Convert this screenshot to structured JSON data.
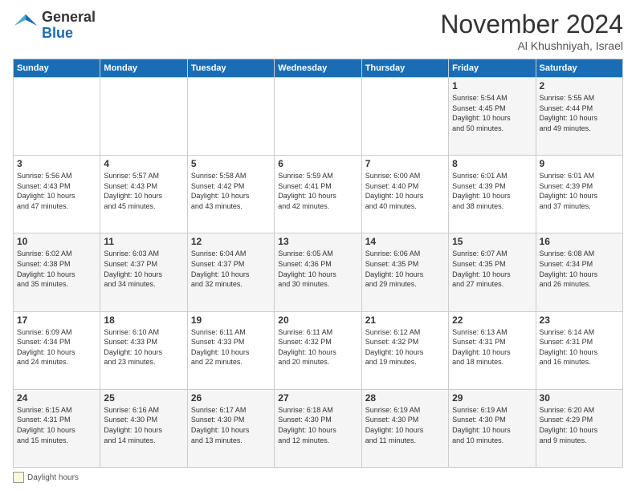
{
  "header": {
    "logo_general": "General",
    "logo_blue": "Blue",
    "month_title": "November 2024",
    "subtitle": "Al Khushniyah, Israel"
  },
  "days_of_week": [
    "Sunday",
    "Monday",
    "Tuesday",
    "Wednesday",
    "Thursday",
    "Friday",
    "Saturday"
  ],
  "weeks": [
    [
      {
        "day": "",
        "info": ""
      },
      {
        "day": "",
        "info": ""
      },
      {
        "day": "",
        "info": ""
      },
      {
        "day": "",
        "info": ""
      },
      {
        "day": "",
        "info": ""
      },
      {
        "day": "1",
        "info": "Sunrise: 5:54 AM\nSunset: 4:45 PM\nDaylight: 10 hours\nand 50 minutes."
      },
      {
        "day": "2",
        "info": "Sunrise: 5:55 AM\nSunset: 4:44 PM\nDaylight: 10 hours\nand 49 minutes."
      }
    ],
    [
      {
        "day": "3",
        "info": "Sunrise: 5:56 AM\nSunset: 4:43 PM\nDaylight: 10 hours\nand 47 minutes."
      },
      {
        "day": "4",
        "info": "Sunrise: 5:57 AM\nSunset: 4:43 PM\nDaylight: 10 hours\nand 45 minutes."
      },
      {
        "day": "5",
        "info": "Sunrise: 5:58 AM\nSunset: 4:42 PM\nDaylight: 10 hours\nand 43 minutes."
      },
      {
        "day": "6",
        "info": "Sunrise: 5:59 AM\nSunset: 4:41 PM\nDaylight: 10 hours\nand 42 minutes."
      },
      {
        "day": "7",
        "info": "Sunrise: 6:00 AM\nSunset: 4:40 PM\nDaylight: 10 hours\nand 40 minutes."
      },
      {
        "day": "8",
        "info": "Sunrise: 6:01 AM\nSunset: 4:39 PM\nDaylight: 10 hours\nand 38 minutes."
      },
      {
        "day": "9",
        "info": "Sunrise: 6:01 AM\nSunset: 4:39 PM\nDaylight: 10 hours\nand 37 minutes."
      }
    ],
    [
      {
        "day": "10",
        "info": "Sunrise: 6:02 AM\nSunset: 4:38 PM\nDaylight: 10 hours\nand 35 minutes."
      },
      {
        "day": "11",
        "info": "Sunrise: 6:03 AM\nSunset: 4:37 PM\nDaylight: 10 hours\nand 34 minutes."
      },
      {
        "day": "12",
        "info": "Sunrise: 6:04 AM\nSunset: 4:37 PM\nDaylight: 10 hours\nand 32 minutes."
      },
      {
        "day": "13",
        "info": "Sunrise: 6:05 AM\nSunset: 4:36 PM\nDaylight: 10 hours\nand 30 minutes."
      },
      {
        "day": "14",
        "info": "Sunrise: 6:06 AM\nSunset: 4:35 PM\nDaylight: 10 hours\nand 29 minutes."
      },
      {
        "day": "15",
        "info": "Sunrise: 6:07 AM\nSunset: 4:35 PM\nDaylight: 10 hours\nand 27 minutes."
      },
      {
        "day": "16",
        "info": "Sunrise: 6:08 AM\nSunset: 4:34 PM\nDaylight: 10 hours\nand 26 minutes."
      }
    ],
    [
      {
        "day": "17",
        "info": "Sunrise: 6:09 AM\nSunset: 4:34 PM\nDaylight: 10 hours\nand 24 minutes."
      },
      {
        "day": "18",
        "info": "Sunrise: 6:10 AM\nSunset: 4:33 PM\nDaylight: 10 hours\nand 23 minutes."
      },
      {
        "day": "19",
        "info": "Sunrise: 6:11 AM\nSunset: 4:33 PM\nDaylight: 10 hours\nand 22 minutes."
      },
      {
        "day": "20",
        "info": "Sunrise: 6:11 AM\nSunset: 4:32 PM\nDaylight: 10 hours\nand 20 minutes."
      },
      {
        "day": "21",
        "info": "Sunrise: 6:12 AM\nSunset: 4:32 PM\nDaylight: 10 hours\nand 19 minutes."
      },
      {
        "day": "22",
        "info": "Sunrise: 6:13 AM\nSunset: 4:31 PM\nDaylight: 10 hours\nand 18 minutes."
      },
      {
        "day": "23",
        "info": "Sunrise: 6:14 AM\nSunset: 4:31 PM\nDaylight: 10 hours\nand 16 minutes."
      }
    ],
    [
      {
        "day": "24",
        "info": "Sunrise: 6:15 AM\nSunset: 4:31 PM\nDaylight: 10 hours\nand 15 minutes."
      },
      {
        "day": "25",
        "info": "Sunrise: 6:16 AM\nSunset: 4:30 PM\nDaylight: 10 hours\nand 14 minutes."
      },
      {
        "day": "26",
        "info": "Sunrise: 6:17 AM\nSunset: 4:30 PM\nDaylight: 10 hours\nand 13 minutes."
      },
      {
        "day": "27",
        "info": "Sunrise: 6:18 AM\nSunset: 4:30 PM\nDaylight: 10 hours\nand 12 minutes."
      },
      {
        "day": "28",
        "info": "Sunrise: 6:19 AM\nSunset: 4:30 PM\nDaylight: 10 hours\nand 11 minutes."
      },
      {
        "day": "29",
        "info": "Sunrise: 6:19 AM\nSunset: 4:30 PM\nDaylight: 10 hours\nand 10 minutes."
      },
      {
        "day": "30",
        "info": "Sunrise: 6:20 AM\nSunset: 4:29 PM\nDaylight: 10 hours\nand 9 minutes."
      }
    ]
  ],
  "footer": {
    "legend_label": "Daylight hours"
  }
}
